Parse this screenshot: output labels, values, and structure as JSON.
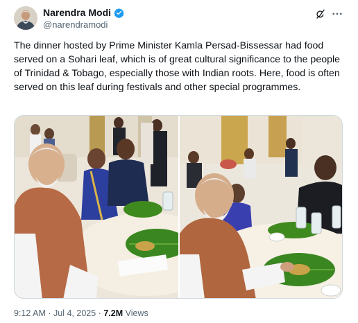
{
  "author": {
    "display_name": "Narendra Modi",
    "handle": "@narendramodi",
    "verified": true,
    "verified_color": "#1d9bf0"
  },
  "header_actions": {
    "grok_icon": "grok-icon",
    "more_icon": "more-options-icon"
  },
  "tweet": {
    "text": "The dinner hosted by Prime Minister Kamla Persad-Bissessar had food served on a Sohari leaf, which is of great cultural significance to the people of Trinidad & Tobago, especially those with Indian roots. Here, food is often served on this leaf during festivals and other special programmes."
  },
  "media": {
    "photo_count": 2
  },
  "meta": {
    "time": "9:12 AM",
    "separator": "·",
    "date": "Jul 4, 2025",
    "views_count": "7.2M",
    "views_label": "Views"
  },
  "colors": {
    "text_primary": "#0f1419",
    "text_secondary": "#536471",
    "border": "#cfd9de",
    "leaf_green": "#3f8a1f"
  }
}
